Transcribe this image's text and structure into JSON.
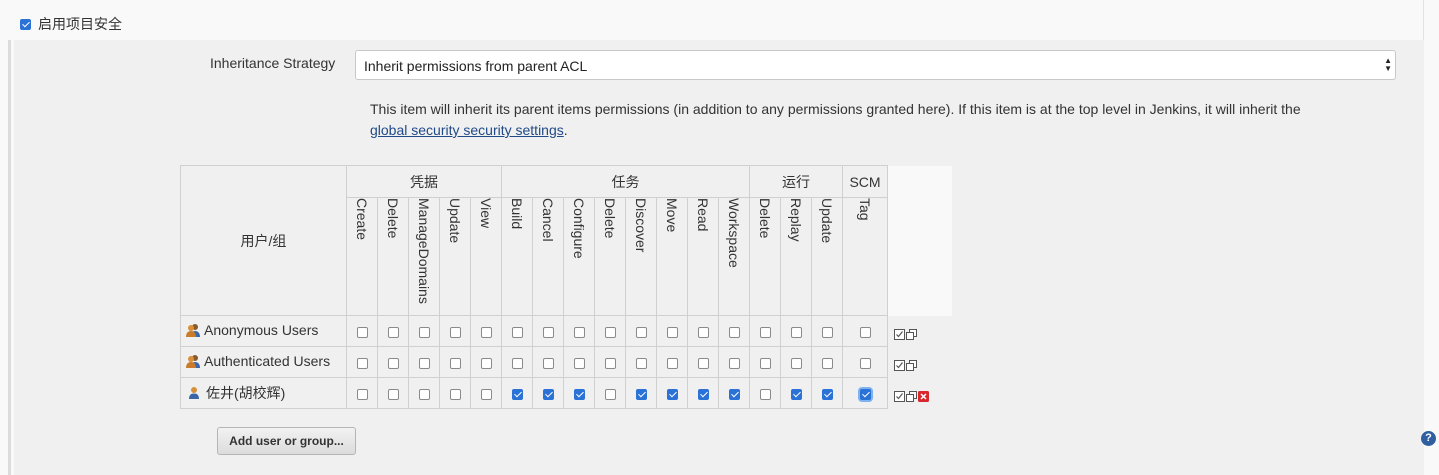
{
  "enable_project_security": {
    "label": "启用项目安全",
    "checked": true
  },
  "inheritance": {
    "label": "Inheritance Strategy",
    "selected": "Inherit permissions from parent ACL",
    "description": "This item will inherit its parent items permissions (in addition to any permissions granted here). If this item is at the top level in Jenkins, it will inherit the",
    "link_text": "global security security settings",
    "after_link": "."
  },
  "matrix": {
    "user_col_header": "用户/组",
    "groups": [
      {
        "name": "凭据",
        "perms": [
          "Create",
          "Delete",
          "ManageDomains",
          "Update",
          "View"
        ]
      },
      {
        "name": "任务",
        "perms": [
          "Build",
          "Cancel",
          "Configure",
          "Delete",
          "Discover",
          "Move",
          "Read",
          "Workspace"
        ]
      },
      {
        "name": "运行",
        "perms": [
          "Delete",
          "Replay",
          "Update"
        ]
      },
      {
        "name": "SCM",
        "perms": [
          "Tag"
        ]
      }
    ],
    "rows": [
      {
        "name": "Anonymous Users",
        "icon": "user-group-icon",
        "values": [
          0,
          0,
          0,
          0,
          0,
          0,
          0,
          0,
          0,
          0,
          0,
          0,
          0,
          0,
          0,
          0,
          0
        ],
        "removable": false
      },
      {
        "name": "Authenticated Users",
        "icon": "user-group-icon",
        "values": [
          0,
          0,
          0,
          0,
          0,
          0,
          0,
          0,
          0,
          0,
          0,
          0,
          0,
          0,
          0,
          0,
          0
        ],
        "removable": false
      },
      {
        "name": "佐井(胡校辉)",
        "icon": "user-icon",
        "values": [
          0,
          0,
          0,
          0,
          0,
          1,
          1,
          1,
          0,
          1,
          1,
          1,
          1,
          0,
          1,
          1,
          1
        ],
        "removable": true
      }
    ]
  },
  "add_button": "Add user or group...",
  "help_icon": "?",
  "colors": {
    "accent": "#2a72d6",
    "link": "#204a87",
    "remove": "#d9272e"
  }
}
